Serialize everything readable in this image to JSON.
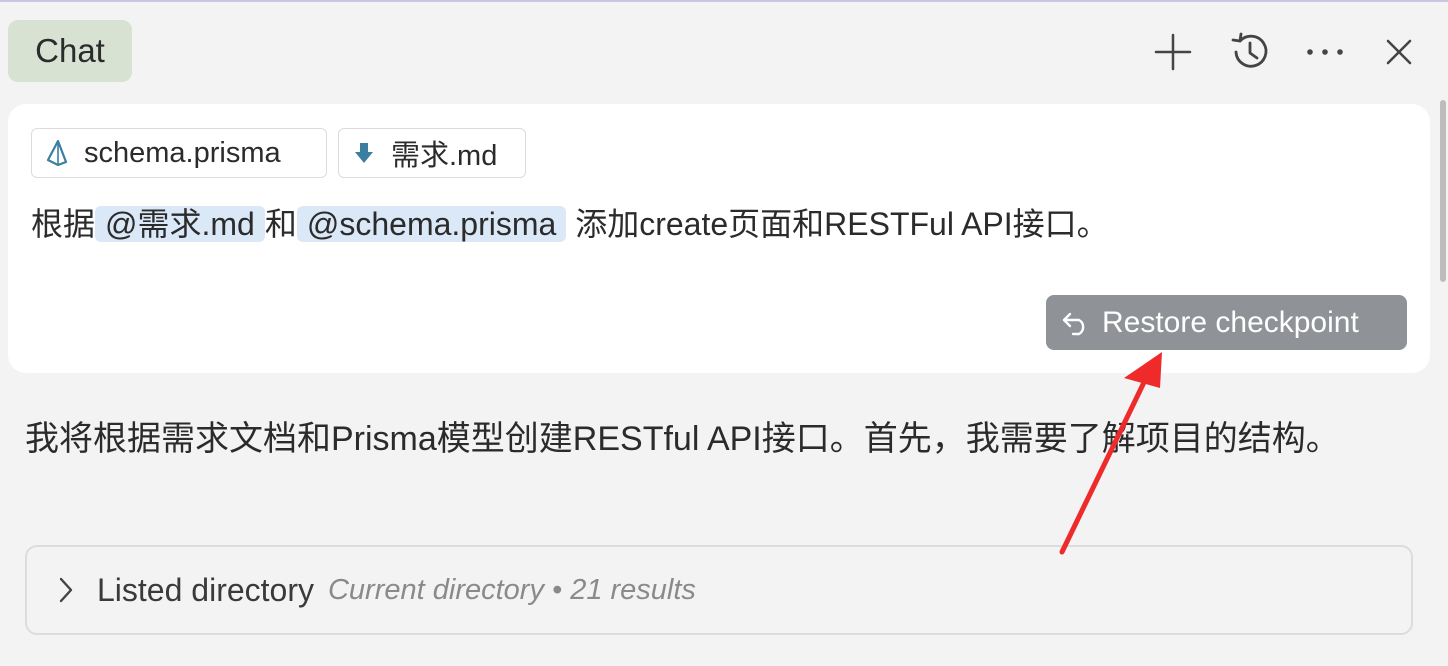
{
  "header": {
    "tab_label": "Chat",
    "icons": [
      "plus-icon",
      "history-icon",
      "more-icon",
      "close-icon"
    ]
  },
  "user_message": {
    "attachments": [
      {
        "name": "schema.prisma",
        "icon": "prisma-icon"
      },
      {
        "name": "需求.md",
        "icon": "markdown-icon"
      }
    ],
    "text_prefix": "根据",
    "mention_1": "@需求.md",
    "text_middle": "和",
    "mention_2": "@schema.prisma",
    "text_suffix": " 添加create页面和RESTFul API接口。",
    "restore_label": "Restore checkpoint"
  },
  "assistant": {
    "text": "我将根据需求文档和Prisma模型创建RESTful API接口。首先，我需要了解项目的结构。"
  },
  "tool_result": {
    "title": "Listed directory",
    "meta": "Current directory • 21 results"
  },
  "colors": {
    "chat_tab_bg": "#d8e2d3",
    "mention_bg": "#dbe8f7",
    "restore_bg": "#8f9296",
    "annotation_arrow": "#ee2a2a"
  }
}
